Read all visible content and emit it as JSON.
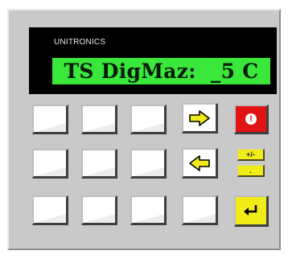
{
  "device": {
    "brand": "UNITRONICS",
    "display_text": "TS DigMaz:  _5 C"
  },
  "keys": {
    "esc_symbol": "!",
    "plus_minus_label": "+/-",
    "dot_label": "."
  },
  "colors": {
    "lcd_green": "#39e83a",
    "esc_red": "#e01414",
    "function_yellow": "#f1ec18"
  }
}
